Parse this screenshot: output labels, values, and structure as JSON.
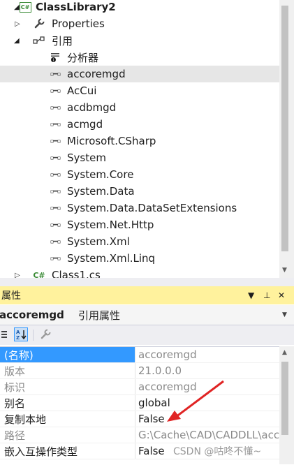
{
  "tree": {
    "project_label": "ClassLibrary2",
    "properties_label": "Properties",
    "references_label": "引用",
    "analyzers_label": "分析器",
    "references": [
      "accoremgd",
      "AcCui",
      "acdbmgd",
      "acmgd",
      "Microsoft.CSharp",
      "System",
      "System.Core",
      "System.Data",
      "System.Data.DataSetExtensions",
      "System.Net.Http",
      "System.Xml",
      "System.Xml.Linq"
    ],
    "selected_reference": "accoremgd",
    "class_file_label": "Class1.cs",
    "cs_badge": "C#"
  },
  "properties_panel": {
    "title": "属性",
    "title_buttons": {
      "dropdown": "▼",
      "pin": "⊥",
      "close": "✕"
    },
    "object_name": "accoremgd",
    "object_type": "引用属性",
    "rows": [
      {
        "name": "(名称)",
        "value": "accoremgd",
        "selected": true,
        "readonly": true
      },
      {
        "name": "版本",
        "value": "21.0.0.0",
        "selected": false,
        "readonly": true
      },
      {
        "name": "标识",
        "value": "accoremgd",
        "selected": false,
        "readonly": true
      },
      {
        "name": "别名",
        "value": "global",
        "selected": false,
        "readonly": false
      },
      {
        "name": "复制本地",
        "value": "False",
        "selected": false,
        "readonly": false
      },
      {
        "name": "路径",
        "value": "G:\\Cache\\CAD\\CADDLL\\acc",
        "selected": false,
        "readonly": true
      },
      {
        "name": "嵌入互操作类型",
        "value": "False",
        "selected": false,
        "readonly": false
      }
    ]
  },
  "watermark": "CSDN @咕咚不懂~",
  "colors": {
    "title_bar": "#fff29d",
    "selection": "#3399ff",
    "annotation_arrow": "#e02424"
  }
}
